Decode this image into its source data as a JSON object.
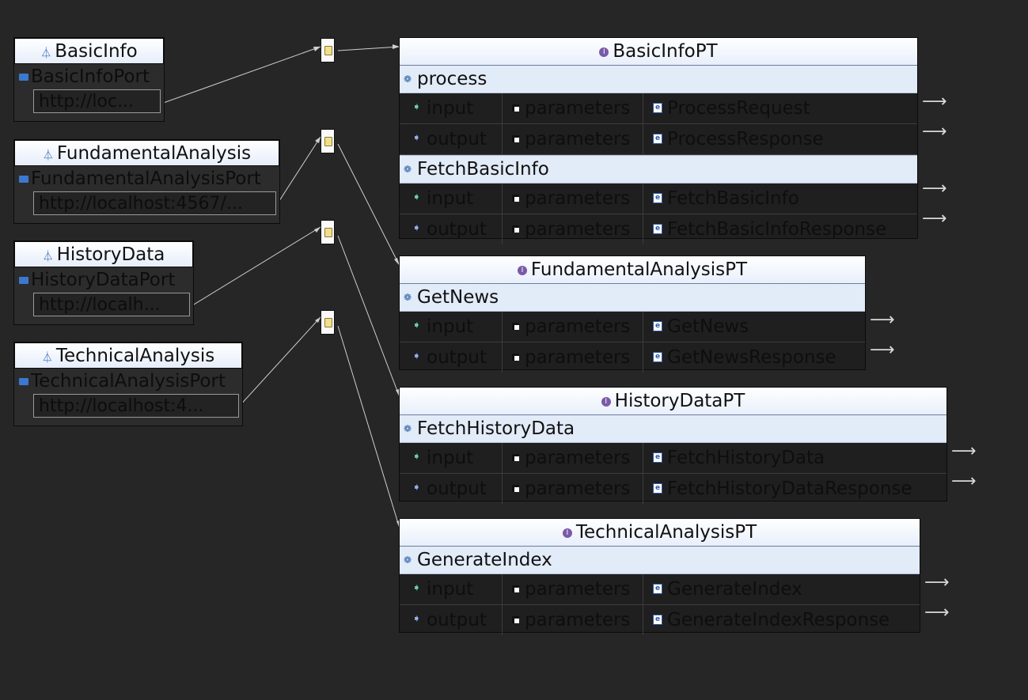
{
  "services": [
    {
      "name": "BasicInfo",
      "port": "BasicInfoPort",
      "address": "http://loc..."
    },
    {
      "name": "FundamentalAnalysis",
      "port": "FundamentalAnalysisPort",
      "address": "http://localhost:4567/..."
    },
    {
      "name": "HistoryData",
      "port": "HistoryDataPort",
      "address": "http://localh..."
    },
    {
      "name": "TechnicalAnalysis",
      "port": "TechnicalAnalysisPort",
      "address": "http://localhost:4..."
    }
  ],
  "port_types": [
    {
      "name": "BasicInfoPT",
      "operations": [
        {
          "name": "process",
          "input": {
            "dir": "input",
            "part": "parameters",
            "element": "ProcessRequest"
          },
          "output": {
            "dir": "output",
            "part": "parameters",
            "element": "ProcessResponse"
          }
        },
        {
          "name": "FetchBasicInfo",
          "input": {
            "dir": "input",
            "part": "parameters",
            "element": "FetchBasicInfo"
          },
          "output": {
            "dir": "output",
            "part": "parameters",
            "element": "FetchBasicInfoResponse"
          }
        }
      ]
    },
    {
      "name": "FundamentalAnalysisPT",
      "operations": [
        {
          "name": "GetNews",
          "input": {
            "dir": "input",
            "part": "parameters",
            "element": "GetNews"
          },
          "output": {
            "dir": "output",
            "part": "parameters",
            "element": "GetNewsResponse"
          }
        }
      ]
    },
    {
      "name": "HistoryDataPT",
      "operations": [
        {
          "name": "FetchHistoryData",
          "input": {
            "dir": "input",
            "part": "parameters",
            "element": "FetchHistoryData"
          },
          "output": {
            "dir": "output",
            "part": "parameters",
            "element": "FetchHistoryDataResponse"
          }
        }
      ]
    },
    {
      "name": "TechnicalAnalysisPT",
      "operations": [
        {
          "name": "GenerateIndex",
          "input": {
            "dir": "input",
            "part": "parameters",
            "element": "GenerateIndex"
          },
          "output": {
            "dir": "output",
            "part": "parameters",
            "element": "GenerateIndexResponse"
          }
        }
      ]
    }
  ],
  "icons": {
    "service": "service-icon",
    "port": "port-icon",
    "binding": "binding-icon",
    "port_type": "porttype-icon",
    "operation": "operation-icon",
    "input": "input-icon",
    "output": "output-icon",
    "part": "part-icon",
    "element": "element-icon",
    "arrow": "arrow-right-icon"
  },
  "colors": {
    "background": "#262626",
    "header": "#e2ebf8",
    "wire": "#cfcfcf",
    "node": "#fafafa"
  }
}
